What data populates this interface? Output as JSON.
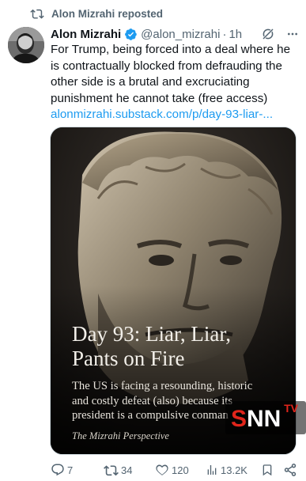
{
  "repost": {
    "text": "Alon Mizrahi reposted",
    "icon": "repost-icon"
  },
  "author": {
    "name": "Alon Mizrahi",
    "handle": "@alon_mizrahi",
    "separator": "·",
    "time": "1h",
    "verified_color": "#1d9bf0"
  },
  "tweet": {
    "text": "For Trump, being forced into a deal where he is contractually blocked from defrauding the other side is a brutal and excruciating punishment he cannot take (free access)",
    "link": "alonmizrahi.substack.com/p/day-93-liar-..."
  },
  "card": {
    "title": "Day 93: Liar, Liar, Pants on Fire",
    "subtitle": "The US is facing a resounding, historic and costly defeat (also) because its president is a compulsive conman",
    "brand": "The Mizrahi Perspective"
  },
  "watermark": {
    "s": "S",
    "nn": "NN",
    "tv": "TV"
  },
  "actions": {
    "replies": "7",
    "reposts": "34",
    "likes": "120",
    "views": "13.2K"
  },
  "colors": {
    "accent": "#1d9bf0",
    "muted": "#536471",
    "repost_active": "#536471"
  }
}
